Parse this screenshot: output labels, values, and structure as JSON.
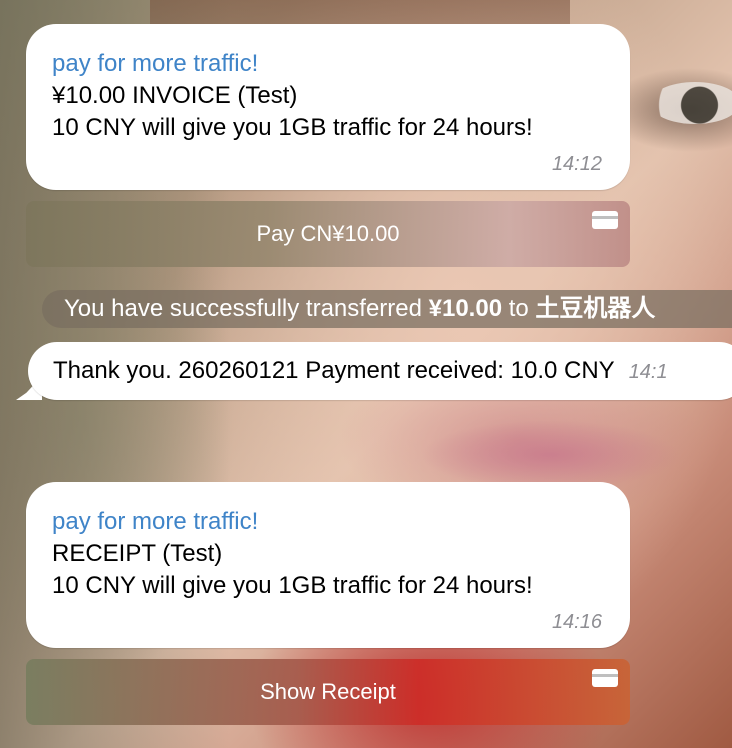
{
  "messages": {
    "invoice": {
      "sender": "pay for more traffic!",
      "title": "¥10.00 INVOICE (Test)",
      "description": "10 CNY will give you 1GB traffic for 24 hours!",
      "time": "14:12",
      "button_label": "Pay CN¥10.00",
      "button_icon": "credit-card-icon"
    },
    "service": {
      "prefix": "You have successfully transferred ",
      "amount": "¥10.00",
      "middle": " to ",
      "recipient": "土豆机器人"
    },
    "incoming": {
      "text": "Thank you. 260260121 Payment received: 10.0 CNY",
      "time": "14:1"
    },
    "receipt": {
      "sender": "pay for more traffic!",
      "title": "RECEIPT (Test)",
      "description": "10 CNY will give you 1GB traffic for 24 hours!",
      "time": "14:16",
      "button_label": "Show Receipt",
      "button_icon": "credit-card-icon"
    }
  },
  "colors": {
    "sender_name": "#3f84c8",
    "timestamp": "#8e8e93",
    "bubble_background": "#ffffff"
  }
}
